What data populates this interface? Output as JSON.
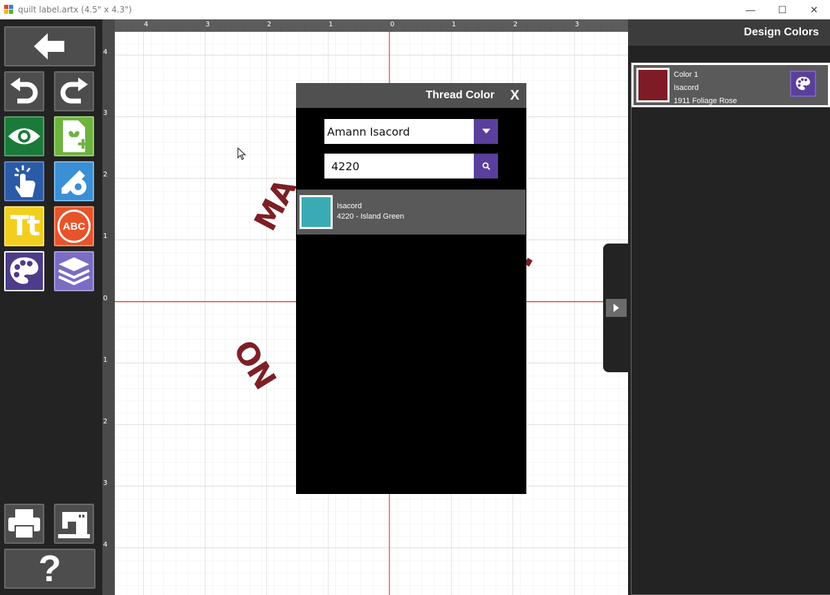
{
  "window": {
    "title": "quilt label.artx (4.5\" x 4.3\")",
    "minimize": "—",
    "maximize": "☐",
    "close": "✕"
  },
  "toolbar": {
    "icons": [
      "back-arrow-icon",
      "undo-icon",
      "redo-icon",
      "view-eye-icon",
      "add-design-icon",
      "select-touch-icon",
      "edit-settings-icon",
      "text-icon",
      "monogram-icon",
      "palette-icon",
      "layers-icon",
      "print-icon",
      "sewing-machine-icon",
      "help-icon"
    ],
    "text_label": "Tt",
    "monogram_label": "ABC",
    "help_label": "?"
  },
  "rulers": {
    "top": [
      "4",
      "3",
      "2",
      "1",
      "0",
      "1",
      "2",
      "3"
    ],
    "left": [
      "4",
      "3",
      "2",
      "1",
      "0",
      "1",
      "2",
      "3",
      "4"
    ]
  },
  "canvas": {
    "embroidery_top": "MA",
    "embroidery_bottom": "ON",
    "embroidery_color": "#7e1f24"
  },
  "design_colors": {
    "title": "Design Colors",
    "items": [
      {
        "name": "Color 1",
        "brand": "Isacord",
        "thread": "1911 Foliage Rose",
        "swatch": "#7e1b24"
      }
    ]
  },
  "thread_dialog": {
    "title": "Thread Color",
    "close_label": "X",
    "brand_value": "Amann Isacord",
    "search_value": "4220",
    "results": [
      {
        "brand": "Isacord",
        "thread": "4220 - Island Green",
        "swatch": "#3aabb4"
      }
    ]
  },
  "colors": {
    "accent_purple": "#5b3f9c",
    "toolbar_bg": "#232323",
    "grid_axis": "#d9383a"
  }
}
